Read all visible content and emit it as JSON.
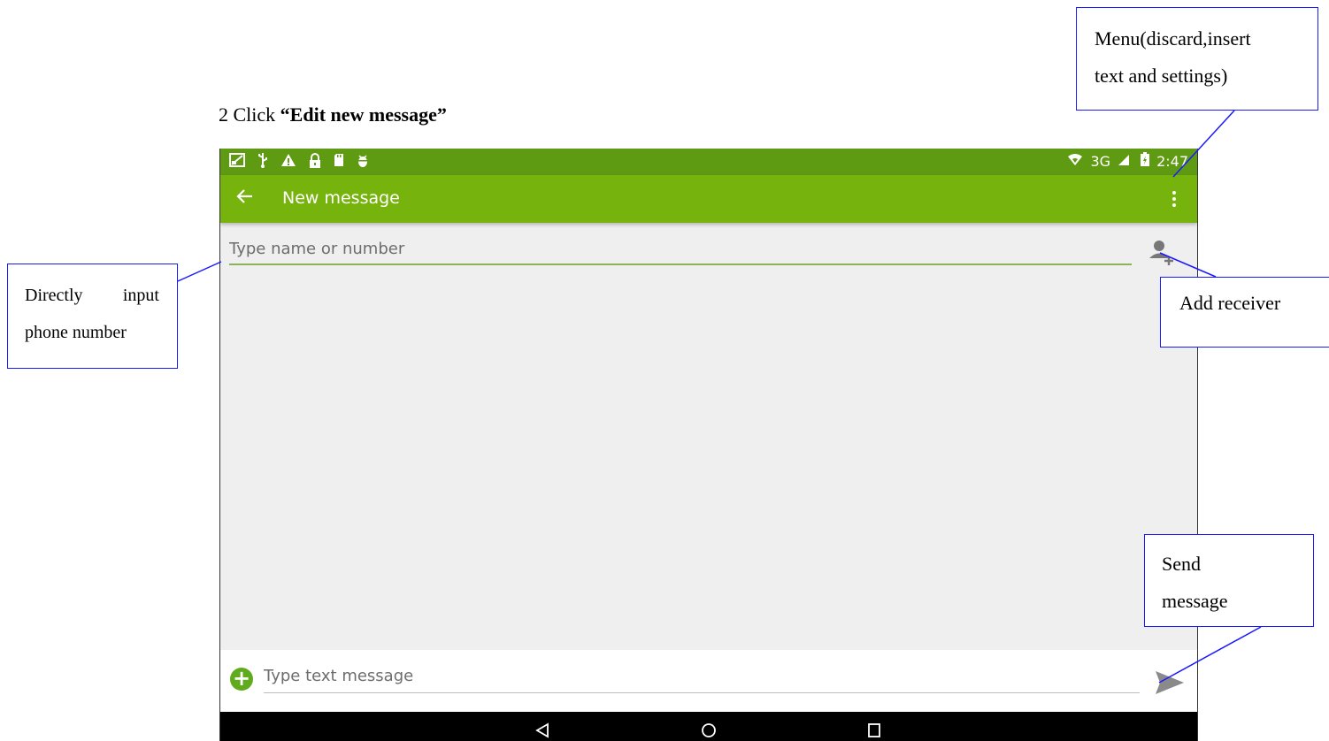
{
  "document": {
    "step_number": "2",
    "step_text": "Click",
    "step_target": "“Edit new message”"
  },
  "callouts": {
    "menu": [
      "Menu(discard,insert",
      "text and settings)"
    ],
    "input_line1_a": "Directly",
    "input_line1_b": "input",
    "input_line2": "phone number",
    "receiver": "Add receiver",
    "send": [
      "Send",
      "message"
    ]
  },
  "statusbar": {
    "network": "3G",
    "time": "2:47",
    "icons": [
      "screenshot-icon",
      "usb-icon",
      "warning-icon",
      "lock-icon",
      "sd-card-icon",
      "android-debug-icon"
    ]
  },
  "appbar": {
    "title": "New message",
    "bg_color": "#76b30d",
    "status_color": "#5f9b12"
  },
  "recipient": {
    "placeholder": "Type name or number",
    "value": ""
  },
  "composer": {
    "placeholder": "Type text message",
    "value": "",
    "attach_color": "#5fab1d"
  }
}
